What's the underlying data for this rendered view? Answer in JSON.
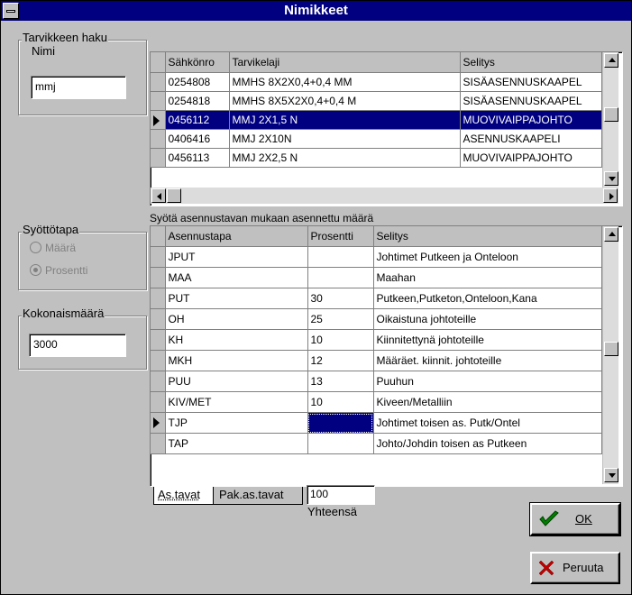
{
  "window": {
    "title": "Nimikkeet"
  },
  "search": {
    "group_label": "Tarvikkeen haku",
    "field_label": "Nimi",
    "value": "mmj"
  },
  "top_grid": {
    "columns": [
      "Sähkönro",
      "Tarvikelaji",
      "Selitys"
    ],
    "rows": [
      [
        "0254808",
        "MMHS 8X2X0,4+0,4 MM",
        "SISÄASENNUSKAAPEL"
      ],
      [
        "0254818",
        "MMHS 8X5X2X0,4+0,4 M",
        "SISÄASENNUSKAAPEL"
      ],
      [
        "0456112",
        "MMJ 2X1,5 N",
        "MUOVIVAIPPAJOHTO"
      ],
      [
        "0406416",
        "MMJ 2X10N",
        "ASENNUSKAAPELI"
      ],
      [
        "0456113",
        "MMJ 2X2,5 N",
        "MUOVIVAIPPAJOHTO"
      ]
    ],
    "selected_row": 2
  },
  "syotto": {
    "group_label": "Syöttötapa",
    "options": [
      "Määrä",
      "Prosentti"
    ],
    "selected": "Prosentti"
  },
  "total": {
    "group_label": "Kokonaismäärä",
    "value": "3000"
  },
  "grid_caption": "Syötä asennustavan mukaan asennettu määrä",
  "bottom_grid": {
    "columns": [
      "Asennustapa",
      "Prosentti",
      "Selitys"
    ],
    "rows": [
      [
        "JPUT",
        "",
        "Johtimet Putkeen ja Onteloon"
      ],
      [
        "MAA",
        "",
        "Maahan"
      ],
      [
        "PUT",
        "30",
        "Putkeen,Putketon,Onteloon,Kana"
      ],
      [
        "OH",
        "25",
        "Oikaistuna johtoteille"
      ],
      [
        "KH",
        "10",
        "Kiinnitettynä johtoteille"
      ],
      [
        "MKH",
        "12",
        "Määräet. kiinnit. johtoteille"
      ],
      [
        "PUU",
        "13",
        "Puuhun"
      ],
      [
        "KIV/MET",
        "10",
        "Kiveen/Metalliin"
      ],
      [
        "TJP",
        "",
        "Johtimet toisen as. Putk/Ontel"
      ],
      [
        "TAP",
        "",
        "Johto/Johdin toisen as Putkeen"
      ]
    ],
    "current_row": 8
  },
  "tabs": [
    "As.tavat",
    "Pak.as.tavat"
  ],
  "sum": {
    "value": "100",
    "label": "Yhteensä"
  },
  "buttons": {
    "ok": "OK",
    "cancel": "Peruuta"
  },
  "colors": {
    "titlebar": "#000080",
    "face": "#c0c0c0",
    "ok_check": "#008000",
    "cancel_x": "#c00000"
  }
}
